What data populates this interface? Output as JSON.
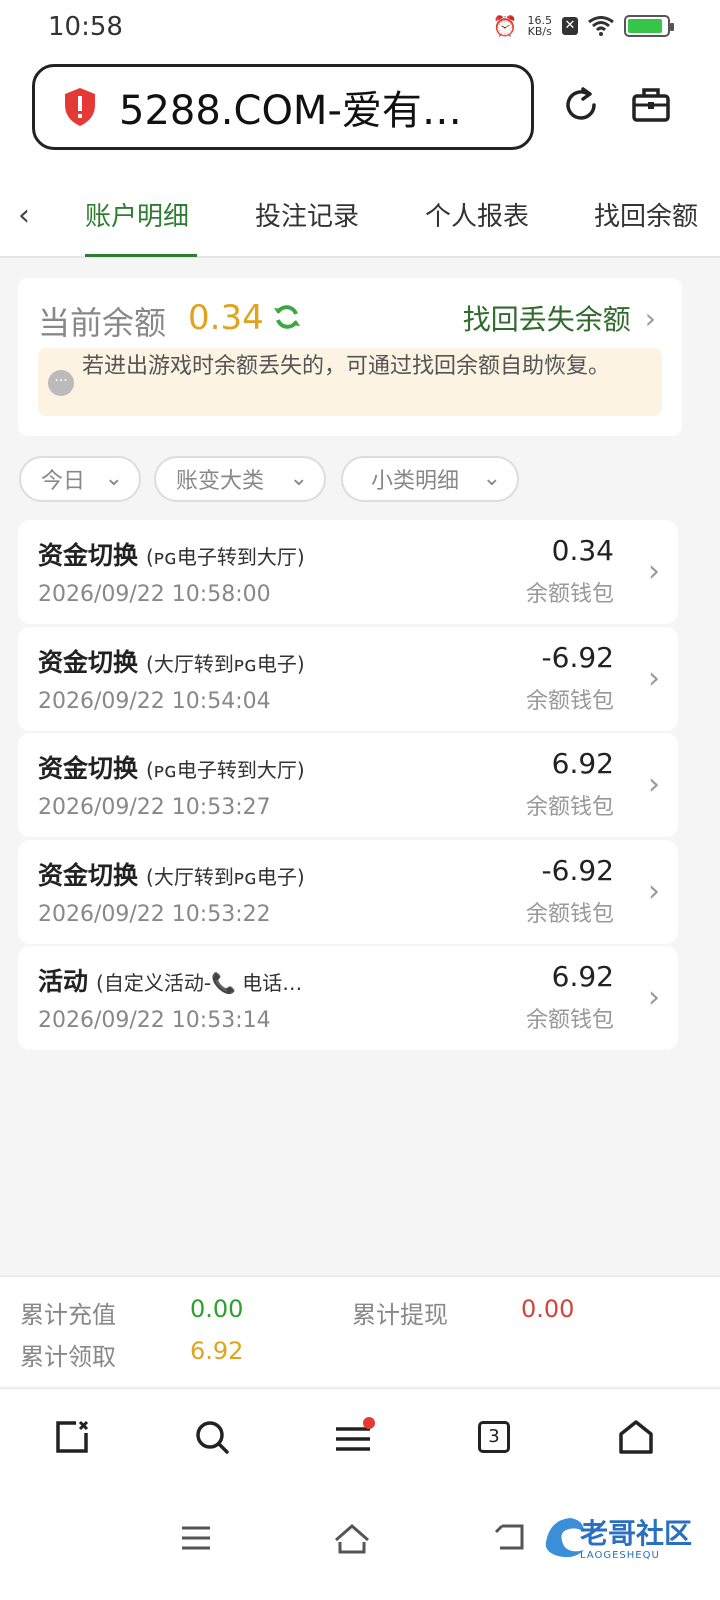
{
  "status": {
    "time": "10:58",
    "net_speed_top": "16.5",
    "net_speed_bottom": "KB/s",
    "battery_level": 0.9
  },
  "browser": {
    "url": "5288.COM-爱有…"
  },
  "tabs": {
    "items": [
      "账户明细",
      "投注记录",
      "个人报表",
      "找回余额"
    ]
  },
  "balance": {
    "label": "当前余额",
    "value": "0.34",
    "recover_link": "找回丢失余额",
    "tip": "若进出游戏时余额丢失的，可通过找回余额自助恢复。"
  },
  "filters": {
    "today": "今日",
    "category": "账变大类",
    "subcategory": "小类明细"
  },
  "records": [
    {
      "type": "资金切换",
      "detail": "(ᴘɢ电子转到大厅)",
      "date": "2026/09/22 10:58:00",
      "amount": "0.34",
      "wallet": "余额钱包"
    },
    {
      "type": "资金切换",
      "detail": "(大厅转到ᴘɢ电子)",
      "date": "2026/09/22 10:54:04",
      "amount": "-6.92",
      "wallet": "余额钱包"
    },
    {
      "type": "资金切换",
      "detail": "(ᴘɢ电子转到大厅)",
      "date": "2026/09/22 10:53:27",
      "amount": "6.92",
      "wallet": "余额钱包"
    },
    {
      "type": "资金切换",
      "detail": "(大厅转到ᴘɢ电子)",
      "date": "2026/09/22 10:53:22",
      "amount": "-6.92",
      "wallet": "余额钱包"
    },
    {
      "type": "活动",
      "detail": "(自定义活动-📞 电话…",
      "date": "2026/09/22 10:53:14",
      "amount": "6.92",
      "wallet": "余额钱包"
    }
  ],
  "totals": {
    "deposit_label": "累计充值",
    "deposit_value": "0.00",
    "withdraw_label": "累计提现",
    "withdraw_value": "0.00",
    "claimed_label": "累计领取",
    "claimed_value": "6.92"
  },
  "bottom_nav": {
    "tab_count": "3"
  },
  "watermark": {
    "text": "老哥社区",
    "subtext": "LAOGESHEQU"
  },
  "colors": {
    "accent_green": "#2f7d32",
    "balance_gold": "#e0a31e",
    "deposit_green": "#2e9e2e",
    "withdraw_red": "#d0453b",
    "alert_red": "#e53935"
  }
}
